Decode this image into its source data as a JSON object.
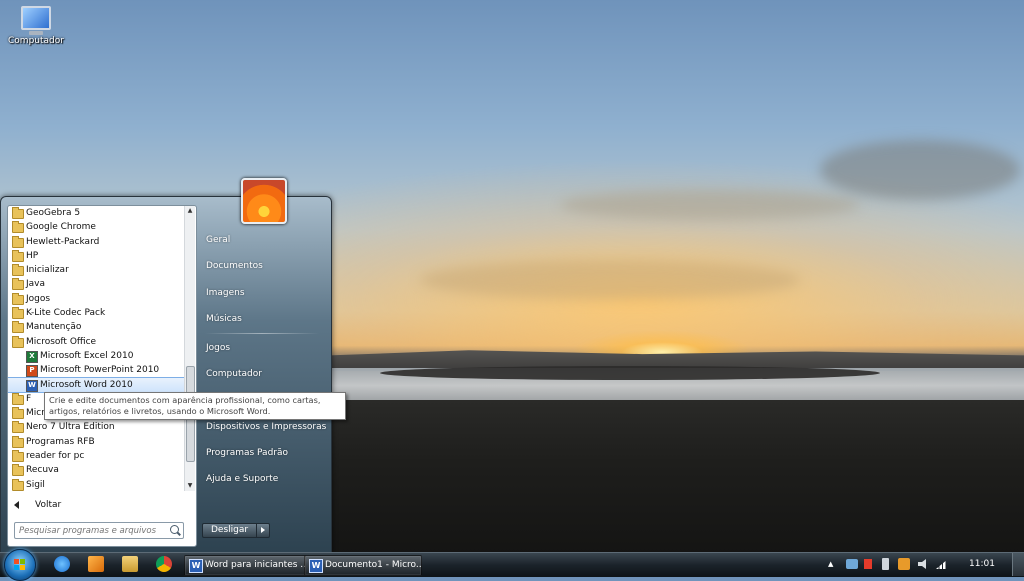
{
  "desktop": {
    "icon_label": "Computador"
  },
  "start_menu": {
    "programs": [
      {
        "label": "GeoGebra 5",
        "type": "folder"
      },
      {
        "label": "Google Chrome",
        "type": "folder"
      },
      {
        "label": "Hewlett-Packard",
        "type": "folder"
      },
      {
        "label": "HP",
        "type": "folder"
      },
      {
        "label": "Inicializar",
        "type": "folder"
      },
      {
        "label": "Java",
        "type": "folder"
      },
      {
        "label": "Jogos",
        "type": "folder"
      },
      {
        "label": "K-Lite Codec Pack",
        "type": "folder"
      },
      {
        "label": "Manutenção",
        "type": "folder"
      },
      {
        "label": "Microsoft Office",
        "type": "folder"
      },
      {
        "label": "Microsoft Excel 2010",
        "type": "app",
        "glyph": "X",
        "color": "#1e7a3a"
      },
      {
        "label": "Microsoft PowerPoint 2010",
        "type": "app",
        "glyph": "P",
        "color": "#d04a1a"
      },
      {
        "label": "Microsoft Word 2010",
        "type": "app",
        "glyph": "W",
        "color": "#2b5fb4"
      },
      {
        "label": "F",
        "type": "folder"
      },
      {
        "label": "Micr",
        "type": "folder"
      },
      {
        "label": "Nero 7 Ultra Edition",
        "type": "folder"
      },
      {
        "label": "Programas RFB",
        "type": "folder"
      },
      {
        "label": "reader for pc",
        "type": "folder"
      },
      {
        "label": "Recuva",
        "type": "folder"
      },
      {
        "label": "Sigil",
        "type": "folder"
      }
    ],
    "selected_program": "Microsoft Word 2010",
    "back_label": "Voltar",
    "search_placeholder": "Pesquisar programas e arquivos",
    "right_items": {
      "geral": "Geral",
      "documentos": "Documentos",
      "imagens": "Imagens",
      "musicas": "Músicas",
      "jogos": "Jogos",
      "computador": "Computador",
      "dispositivos": "Dispositivos e Impressoras",
      "programas_padrao": "Programas Padrão",
      "ajuda": "Ajuda e Suporte"
    },
    "shutdown_label": "Desligar",
    "tooltip": "Crie e edite documentos com aparência profissional, como cartas, artigos, relatórios e livretos, usando o Microsoft Word."
  },
  "taskbar": {
    "windows": [
      {
        "label": "Word para iniciantes ..."
      },
      {
        "label": "Documento1 - Micro..."
      }
    ],
    "clock": "11:01"
  },
  "colors": {
    "taskbar": "#1b232a",
    "accent": "#2b5fb4",
    "folder": "#e8c25a"
  }
}
